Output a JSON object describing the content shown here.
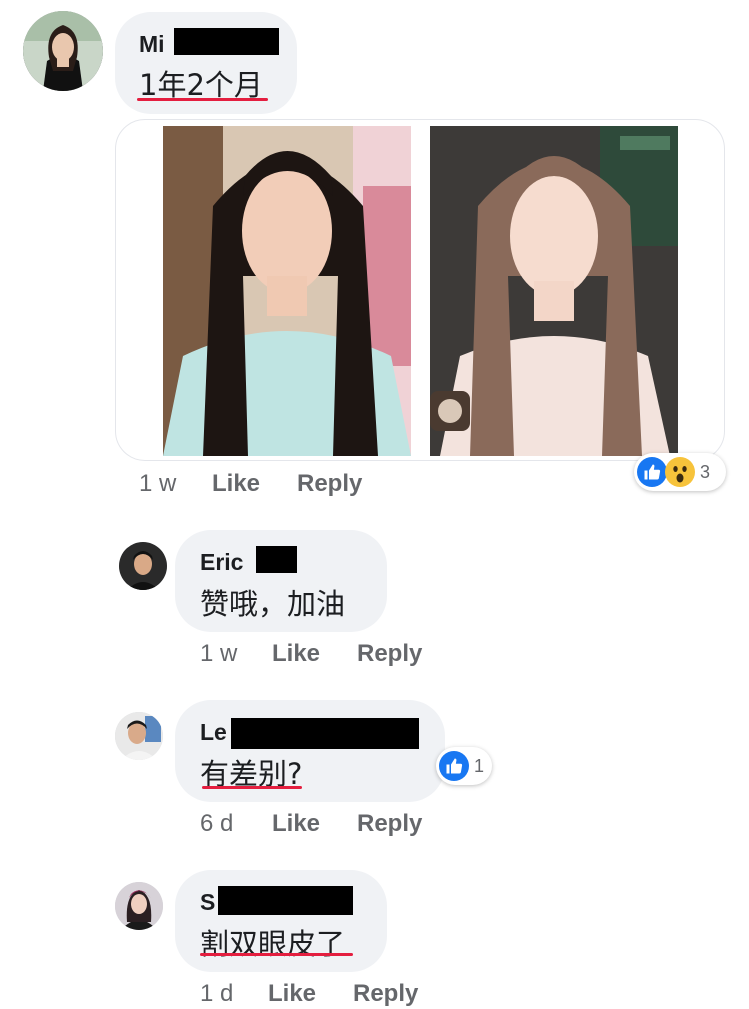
{
  "comments": [
    {
      "author_visible": "Mi",
      "text": "1年2个月",
      "time": "1 w",
      "like_label": "Like",
      "reply_label": "Reply",
      "reaction_count": "3",
      "reactions": [
        "like",
        "wow"
      ]
    },
    {
      "author_visible": "Eric",
      "text": "赞哦，加油",
      "time": "1 w",
      "like_label": "Like",
      "reply_label": "Reply"
    },
    {
      "author_visible": "Le",
      "text": "有差别?",
      "time": "6 d",
      "like_label": "Like",
      "reply_label": "Reply",
      "reaction_count": "1",
      "reactions": [
        "like"
      ]
    },
    {
      "author_visible": "S",
      "text": "割双眼皮了",
      "time": "1 d",
      "like_label": "Like",
      "reply_label": "Reply"
    }
  ],
  "colors": {
    "bubble": "#f0f2f5",
    "meta": "#65676b",
    "like_blue": "#1877f2",
    "annotation_red": "#e41e3f",
    "redaction": "#000000"
  }
}
